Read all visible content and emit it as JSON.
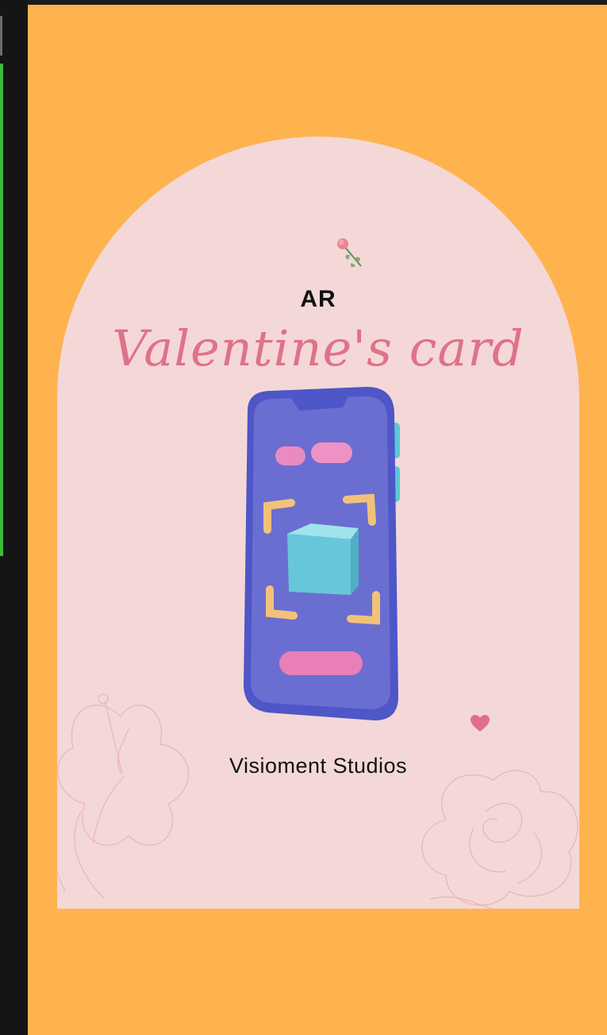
{
  "card": {
    "eyebrow": "AR",
    "title": "Valentine's card",
    "studio": "Visioment Studios"
  },
  "icons": {
    "top": "rose-icon",
    "center": "phone-ar-cube-illustration",
    "accent": "heart-icon",
    "background": [
      "hibiscus-outline-icon",
      "rose-outline-icon"
    ]
  },
  "colors": {
    "background": "#FFB34F",
    "arch": "#F4D8D8",
    "title": "#E0718A",
    "phone": "#6B6FD8",
    "cube": "#6CCCDD"
  }
}
